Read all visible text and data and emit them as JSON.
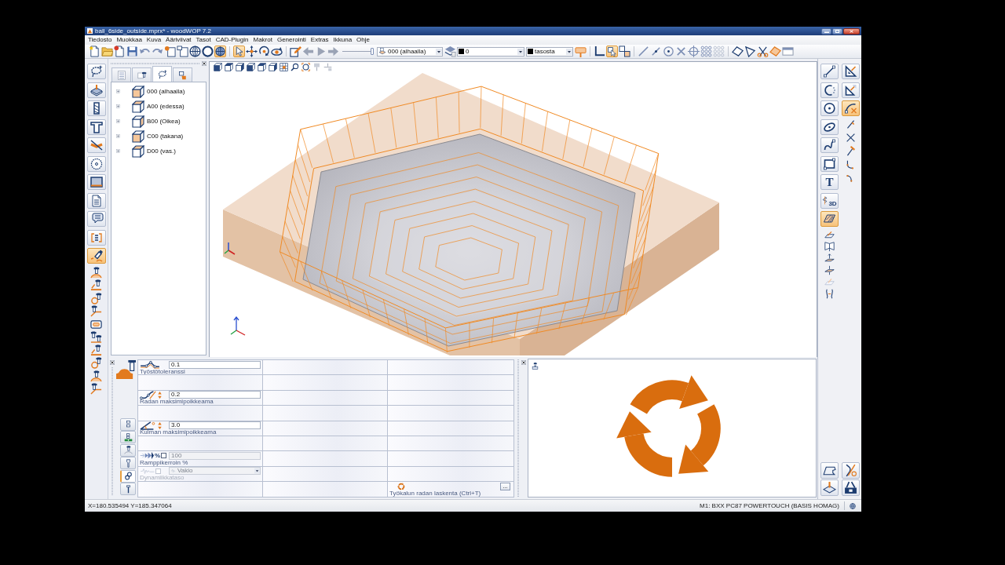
{
  "window": {
    "title": "ball_6side_outside.mprx* - woodWOP 7.2"
  },
  "menu": [
    "Tiedosto",
    "Muokkaa",
    "Kuva",
    "Ääriviivat",
    "Tasot",
    "CAD-Plugin",
    "Makrot",
    "Generointi",
    "Extras",
    "Ikkuna",
    "Ohje"
  ],
  "toolbar": {
    "groups": [
      [
        {
          "kind": "newfile",
          "selected": false
        },
        {
          "kind": "folder",
          "selected": false
        },
        {
          "kind": "newdoc",
          "selected": false
        },
        {
          "kind": "save",
          "selected": false
        },
        {
          "kind": "undo",
          "selected": false
        },
        {
          "kind": "redo",
          "selected": false
        },
        {
          "kind": "pagestar",
          "selected": false
        },
        {
          "kind": "pagegear",
          "selected": false
        },
        {
          "kind": "globe",
          "selected": false
        },
        {
          "kind": "ring",
          "selected": false
        },
        {
          "kind": "globefill",
          "selected": true
        }
      ],
      [
        {
          "kind": "cursor",
          "selected": true
        },
        {
          "kind": "move",
          "selected": false
        },
        {
          "kind": "rotate",
          "selected": false
        },
        {
          "kind": "orbit",
          "selected": false
        }
      ],
      [
        {
          "kind": "pen",
          "selected": false
        },
        {
          "kind": "back",
          "selected": false
        },
        {
          "kind": "play",
          "selected": false
        },
        {
          "kind": "fwd",
          "selected": false
        },
        {
          "kind": "slider",
          "level": 1
        },
        {
          "kind": "planebox",
          "value": "000 (alhaalla)"
        },
        {
          "kind": "layers",
          "selected": false
        },
        {
          "kind": "layerbox",
          "value": "0"
        },
        {
          "kind": "colorbox",
          "value": "tasosta"
        },
        {
          "kind": "brush",
          "selected": false
        }
      ],
      [
        {
          "kind": "angle",
          "selected": false
        },
        {
          "kind": "snap",
          "selected": true
        },
        {
          "kind": "snap2",
          "selected": false
        }
      ],
      [
        {
          "kind": "line",
          "selected": false
        },
        {
          "kind": "line2",
          "selected": false
        },
        {
          "kind": "circdot",
          "selected": false
        },
        {
          "kind": "cross",
          "selected": false
        },
        {
          "kind": "target",
          "selected": false
        },
        {
          "kind": "grid",
          "selected": false
        },
        {
          "kind": "grid2",
          "selected": false
        }
      ],
      [
        {
          "kind": "rhombus",
          "selected": false
        },
        {
          "kind": "triangle",
          "selected": false
        },
        {
          "kind": "scissors",
          "selected": false
        },
        {
          "kind": "rhombus2",
          "selected": false
        },
        {
          "kind": "window",
          "selected": false
        }
      ]
    ]
  },
  "left_tools": [
    {
      "kind": "lasso",
      "selected": false
    },
    {
      "kind": "panel",
      "selected": false
    },
    {
      "kind": "drill",
      "selected": false
    },
    {
      "kind": "beam",
      "selected": false
    },
    {
      "kind": "crosscut",
      "selected": false
    },
    {
      "kind": "blade",
      "selected": false
    },
    {
      "kind": "frame",
      "selected": false
    },
    {
      "kind": "sheet",
      "selected": false
    },
    {
      "kind": "help",
      "selected": false
    },
    {
      "kind": "listbox",
      "selected": false
    },
    {
      "kind": "mill",
      "selected": true
    },
    {
      "kind": "ra",
      "selected": false
    },
    {
      "kind": "rb",
      "selected": false
    },
    {
      "kind": "rc",
      "selected": false
    },
    {
      "kind": "rd",
      "selected": false
    },
    {
      "kind": "rframe",
      "selected": false
    },
    {
      "kind": "rstack",
      "selected": false
    },
    {
      "kind": "rb",
      "selected": false
    },
    {
      "kind": "rc",
      "selected": false
    },
    {
      "kind": "ra",
      "selected": false
    },
    {
      "kind": "rd",
      "selected": false
    }
  ],
  "tree": {
    "tabs": [
      {
        "kind": "listview",
        "selected": false
      },
      {
        "kind": "toolview",
        "selected": false
      },
      {
        "kind": "lassoview",
        "selected": true
      },
      {
        "kind": "handview",
        "selected": false
      }
    ],
    "items": [
      {
        "label": "000 (alhaalla)",
        "expanded": false
      },
      {
        "label": "A00 (edessa)",
        "expanded": false
      },
      {
        "label": "B00 (Oikea)",
        "expanded": false
      },
      {
        "label": "C00 (takana)",
        "expanded": false
      },
      {
        "label": "D00 (vas.)",
        "expanded": false
      }
    ]
  },
  "right_tools": {
    "column_1": [
      {
        "kind": "dline",
        "selected": false
      },
      {
        "kind": "darc",
        "selected": false
      },
      {
        "kind": "dcircle",
        "selected": false
      },
      {
        "kind": "dellipse",
        "selected": false
      },
      {
        "kind": "dspline",
        "selected": false
      },
      {
        "kind": "drect",
        "selected": false
      },
      {
        "kind": "textglyph",
        "text": "T",
        "selected": false
      },
      {
        "kind": "helix",
        "text": "3D",
        "selected": false
      },
      {
        "kind": "dhatch",
        "selected": true
      },
      {
        "kind": "sface",
        "selected": false
      },
      {
        "kind": "smirror",
        "selected": false
      },
      {
        "kind": "slift",
        "selected": false
      },
      {
        "kind": "slayer",
        "selected": false
      },
      {
        "kind": "sface2",
        "selected": false
      },
      {
        "kind": "scurve",
        "selected": false
      }
    ],
    "column_2": [
      {
        "kind": "dtri",
        "selected": false
      },
      {
        "kind": "dtri2",
        "selected": false
      },
      {
        "kind": "dtrim",
        "selected": true
      },
      {
        "kind": "sknife",
        "selected": false
      },
      {
        "kind": "scross",
        "selected": false
      },
      {
        "kind": "shammer",
        "selected": false
      },
      {
        "kind": "scorner",
        "selected": false
      },
      {
        "kind": "scorner2",
        "selected": false
      }
    ],
    "bottom": [
      {
        "kind": "bprofile",
        "selected": false
      },
      {
        "kind": "btools",
        "selected": false
      },
      {
        "kind": "bpanel",
        "selected": false
      },
      {
        "kind": "bbox",
        "selected": false
      }
    ]
  },
  "parameters": {
    "tabs": [
      {
        "kind": "levels",
        "selected": false
      },
      {
        "kind": "levelsplus",
        "selected": false
      },
      {
        "kind": "toolpath",
        "selected": false
      },
      {
        "kind": "clamp",
        "selected": false
      },
      {
        "kind": "links",
        "selected": true
      },
      {
        "kind": "wrench",
        "selected": false
      }
    ],
    "rows": [
      {
        "cells": [
          {
            "kind": "tolerance",
            "value": "0.1",
            "label": "Työstötoleranssi"
          },
          {
            "kind": "blank"
          },
          {
            "kind": "blank"
          }
        ]
      },
      {
        "cells": [
          {
            "kind": "blank"
          },
          {
            "kind": "blank"
          },
          {
            "kind": "blank"
          }
        ]
      },
      {
        "cells": [
          {
            "kind": "deviation",
            "value": "0.2",
            "label": "Radan maksimipoikkeama"
          },
          {
            "kind": "blank"
          },
          {
            "kind": "blank"
          }
        ]
      },
      {
        "cells": [
          {
            "kind": "blank"
          },
          {
            "kind": "blank"
          },
          {
            "kind": "blank"
          }
        ]
      },
      {
        "cells": [
          {
            "kind": "angle",
            "value": "3.0",
            "label": "Kulman maksimipoikkeama"
          },
          {
            "kind": "blank"
          },
          {
            "kind": "blank"
          }
        ]
      },
      {
        "cells": [
          {
            "kind": "blank"
          },
          {
            "kind": "blank"
          },
          {
            "kind": "blank"
          }
        ]
      },
      {
        "cells": [
          {
            "kind": "ramp",
            "unit": "%",
            "checked": false,
            "value": "100",
            "value_disabled": true,
            "label": "Ramppikerroin %"
          },
          {
            "kind": "blank"
          },
          {
            "kind": "blank"
          }
        ]
      },
      {
        "cells": [
          {
            "kind": "dynamics",
            "checked": false,
            "value": "Vakio",
            "disabled": true,
            "label": "Dynamiikkataso"
          },
          {
            "kind": "blank"
          },
          {
            "kind": "blank"
          }
        ]
      },
      {
        "cells": [
          {
            "kind": "blank"
          },
          {
            "kind": "blank"
          },
          {
            "kind": "action",
            "label": "Työkalun radan laskenta (Ctrl+T)",
            "button": "..."
          }
        ]
      }
    ]
  },
  "status_bar": {
    "coordinates": "X=180.535494 Y=185.347064",
    "machine": "M1: BXX PC87 POWERTOUCH (BASIS HOMAG)"
  }
}
